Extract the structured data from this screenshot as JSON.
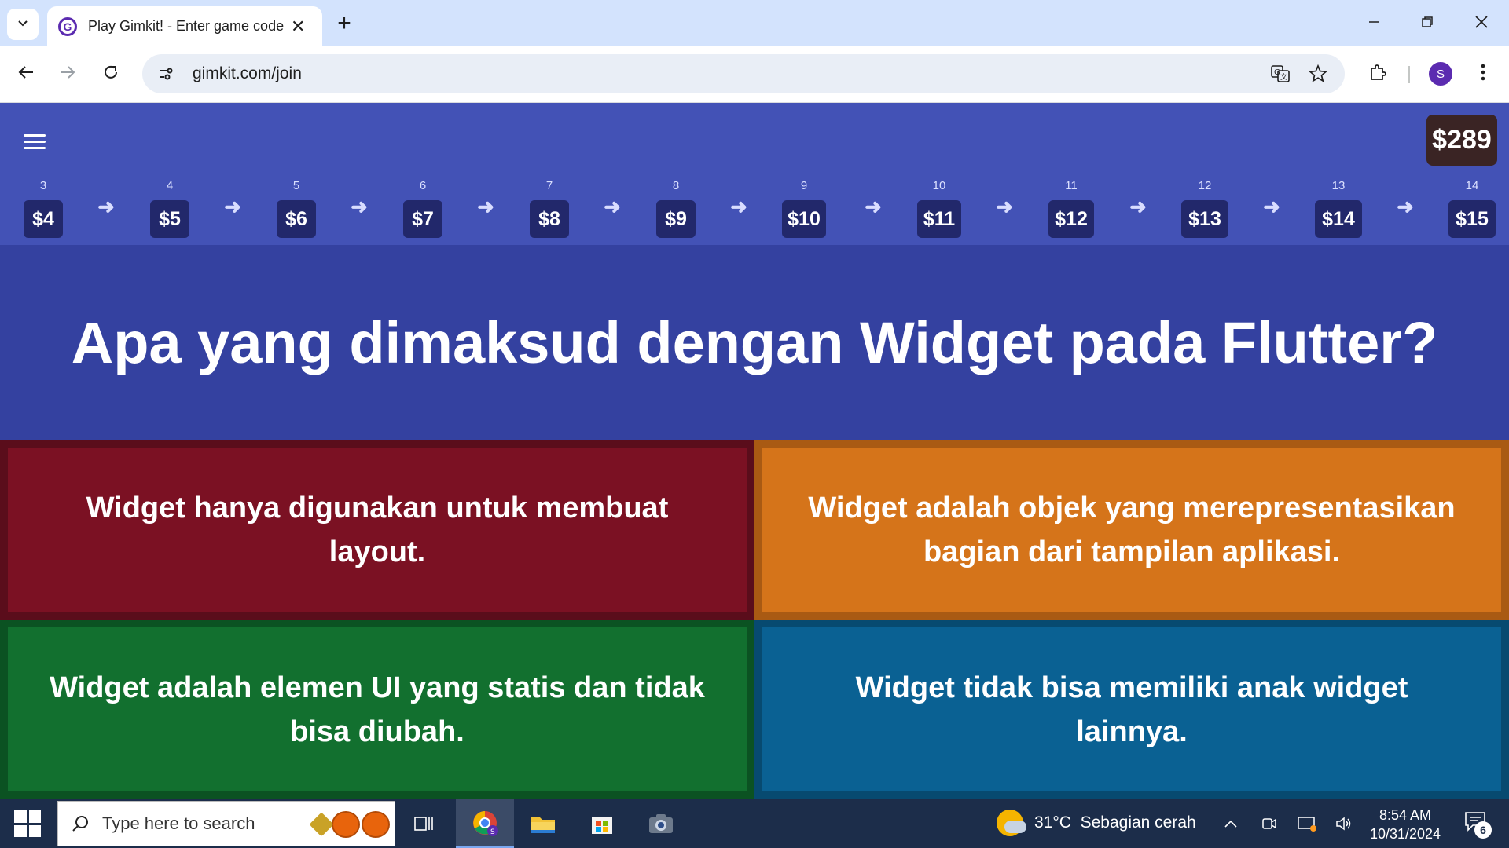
{
  "browser": {
    "tab_title": "Play Gimkit! - Enter game code",
    "favicon_letter": "G",
    "url": "gimkit.com/join",
    "profile_initial": "S",
    "icons": [
      "chevron-down-icon",
      "close-icon",
      "plus-icon",
      "minimize-icon",
      "restore-icon",
      "close-window-icon",
      "back-icon",
      "forward-icon",
      "reload-icon",
      "site-info-icon",
      "translate-icon",
      "star-icon",
      "extensions-icon",
      "more-icon"
    ]
  },
  "game": {
    "balance": "$289",
    "levels": [
      {
        "num": "3",
        "value": "$4"
      },
      {
        "num": "4",
        "value": "$5"
      },
      {
        "num": "5",
        "value": "$6"
      },
      {
        "num": "6",
        "value": "$7"
      },
      {
        "num": "7",
        "value": "$8"
      },
      {
        "num": "8",
        "value": "$9"
      },
      {
        "num": "9",
        "value": "$10"
      },
      {
        "num": "10",
        "value": "$11"
      },
      {
        "num": "11",
        "value": "$12"
      },
      {
        "num": "12",
        "value": "$13"
      },
      {
        "num": "13",
        "value": "$14"
      },
      {
        "num": "14",
        "value": "$15"
      }
    ],
    "question": "Apa yang dimaksud dengan Widget pada Flutter?",
    "answers": [
      {
        "text": "Widget hanya digunakan untuk membuat layout.",
        "color": "#7b1123"
      },
      {
        "text": "Widget adalah objek yang merepresentasikan bagian dari tampilan aplikasi.",
        "color": "#d5741a"
      },
      {
        "text": "Widget adalah elemen UI yang statis dan tidak bisa diubah.",
        "color": "#12702f"
      },
      {
        "text": "Widget tidak bisa memiliki anak widget lainnya.",
        "color": "#0a6193"
      }
    ]
  },
  "taskbar": {
    "search_placeholder": "Type here to search",
    "weather": "31°C  Sebagian cerah",
    "time": "8:54 AM",
    "date": "10/31/2024",
    "notification_count": "6"
  }
}
